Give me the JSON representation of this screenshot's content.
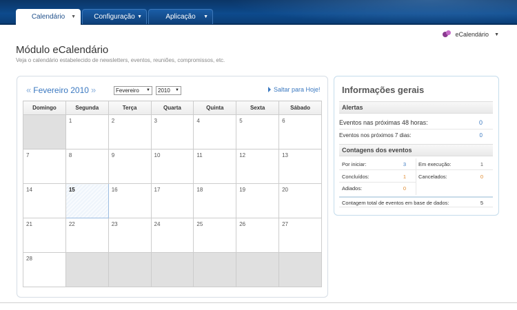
{
  "nav": {
    "tabs": [
      {
        "label": "Calendário",
        "active": true
      },
      {
        "label": "Configuração",
        "active": false
      },
      {
        "label": "Aplicação",
        "active": false
      }
    ]
  },
  "user_menu": {
    "label": "eCalendário",
    "icon": "app-logo-icon"
  },
  "header": {
    "title": "Módulo eCalendário",
    "subtitle": "Veja o calendário estabelecido de newsletters, eventos, reuniões, compromissos, etc."
  },
  "calendar": {
    "month_label": "Fevereiro 2010",
    "prev_icon": "«",
    "next_icon": "»",
    "month_select": "Fevereiro",
    "year_select": "2010",
    "jump_today": "Saltar para Hoje!",
    "weekdays": [
      "Domingo",
      "Segunda",
      "Terça",
      "Quarta",
      "Quinta",
      "Sexta",
      "Sábado"
    ],
    "weeks": [
      [
        "",
        "1",
        "2",
        "3",
        "4",
        "5",
        "6"
      ],
      [
        "7",
        "8",
        "9",
        "10",
        "11",
        "12",
        "13"
      ],
      [
        "14",
        "15",
        "16",
        "17",
        "18",
        "19",
        "20"
      ],
      [
        "21",
        "22",
        "23",
        "24",
        "25",
        "26",
        "27"
      ],
      [
        "28",
        "",
        "",
        "",
        "",
        "",
        ""
      ]
    ],
    "today": "15"
  },
  "info": {
    "title": "Informações gerais",
    "alerts_head": "Alertas",
    "alert_48h_label": "Eventos nas próximas 48 horas:",
    "alert_48h_value": "0",
    "alert_7d_label": "Eventos nos próximos 7 dias:",
    "alert_7d_value": "0",
    "counts_head": "Contagens dos eventos",
    "por_iniciar_label": "Por iniciar:",
    "por_iniciar_value": "3",
    "em_execucao_label": "Em execução:",
    "em_execucao_value": "1",
    "concluidos_label": "Concluídos:",
    "concluidos_value": "1",
    "cancelados_label": "Cancelados:",
    "cancelados_value": "0",
    "adiados_label": "Adiados:",
    "adiados_value": "0",
    "total_label": "Contagem total de eventos em base de dados:",
    "total_value": "5"
  },
  "colors": {
    "topbar": "#0d4a8c",
    "link_blue": "#3a78c0",
    "orange": "#e08a2e",
    "empty_cell": "#e0e0e0"
  }
}
